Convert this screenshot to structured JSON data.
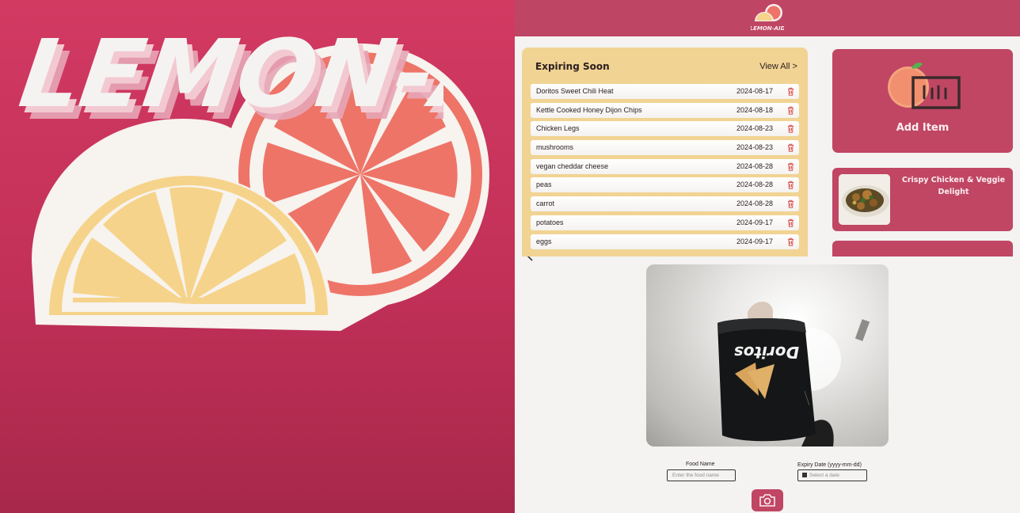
{
  "brand": {
    "title": "LEMON-AID"
  },
  "app": {
    "header_logo_text": "LEMON-AID",
    "expiring": {
      "title": "Expiring Soon",
      "view_all": "View All >",
      "items": [
        {
          "name": "Doritos Sweet Chili Heat",
          "date": "2024-08-17"
        },
        {
          "name": "Kettle Cooked Honey Dijon Chips",
          "date": "2024-08-18"
        },
        {
          "name": "Chicken Legs",
          "date": "2024-08-23"
        },
        {
          "name": "mushrooms",
          "date": "2024-08-23"
        },
        {
          "name": "vegan cheddar cheese",
          "date": "2024-08-28"
        },
        {
          "name": "peas",
          "date": "2024-08-28"
        },
        {
          "name": "carrot",
          "date": "2024-08-28"
        },
        {
          "name": "potatoes",
          "date": "2024-09-17"
        },
        {
          "name": "eggs",
          "date": "2024-09-17"
        }
      ]
    },
    "add_item": {
      "label": "Add Item"
    },
    "recipe": {
      "title": "Crispy Chicken & Veggie Delight"
    }
  },
  "camera": {
    "food_name_label": "Food Name",
    "food_name_placeholder": "Enter the food name",
    "expiry_label": "Expiry Date (yyyy-mm-dd)",
    "expiry_placeholder": "Select a date",
    "snack_brand": "Doritos"
  },
  "colors": {
    "brand_bg": "#c7335c",
    "header": "#bf4564",
    "card_accent": "#c04664",
    "expiring_card": "#f1d393",
    "lemon": "#f6d38a",
    "grapefruit": "#ee7468"
  },
  "icons": [
    "trash-icon",
    "scan-item-icon",
    "camera-icon",
    "back-chevron-icon",
    "calendar-icon"
  ]
}
